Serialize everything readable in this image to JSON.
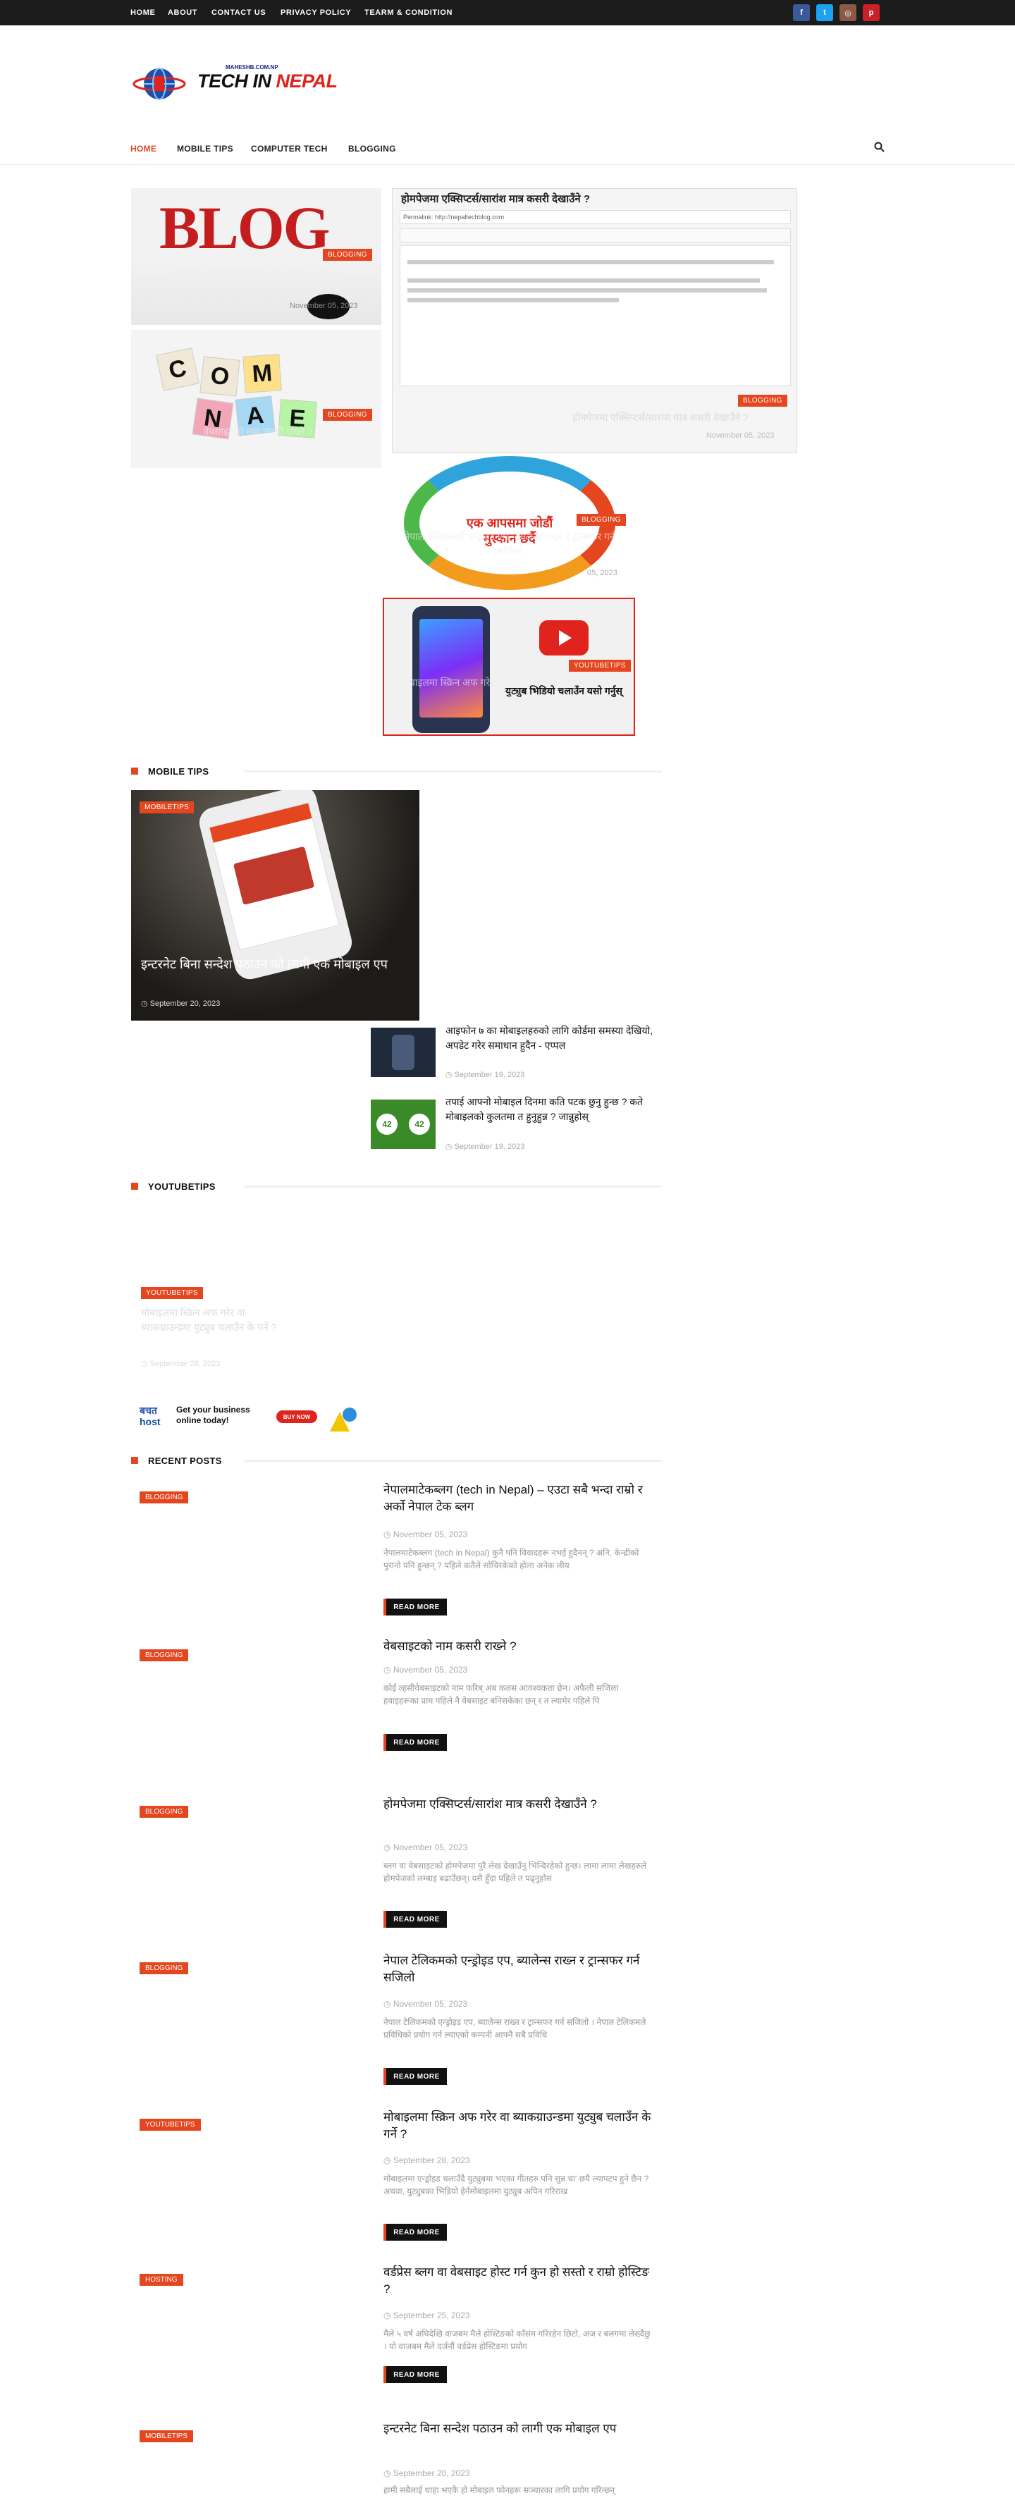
{
  "topbar": {
    "links": [
      "HOME",
      "ABOUT",
      "CONTACT US",
      "PRIVACY POLICY",
      "TEARM & CONDITION"
    ],
    "social": [
      {
        "icon": "facebook-icon",
        "glyph": "f",
        "color": "#3b5998"
      },
      {
        "icon": "twitter-icon",
        "glyph": "t",
        "color": "#1da1f2"
      },
      {
        "icon": "instagram-icon",
        "glyph": "◎",
        "color": "#8a5a44"
      },
      {
        "icon": "pinterest-icon",
        "glyph": "p",
        "color": "#cb2027"
      }
    ]
  },
  "header": {
    "logo_small": "MAHESHB.COM.NP",
    "logo_main": "TECH IN",
    "logo_accent": "NEPAL"
  },
  "nav": {
    "items": [
      "HOME",
      "MOBILE TIPS",
      "COMPUTER TECH",
      "BLOGGING"
    ],
    "search_icon": "search-icon"
  },
  "featured": [
    {
      "badge": "BLOGGING",
      "title": "होमपेजमा एक्सिप्टर्स/सारांश मात्र कसरी देखाउँने ?",
      "date": "November 05, 2023",
      "image_text": "BLOG"
    },
    {
      "badge": "BLOGGING",
      "title": "वेबसाइटको नाम कसरी राख्ने ?",
      "date": "",
      "image_text": "NAME"
    },
    {
      "badge": "BLOGGING",
      "title": "होमपेजमा एक्सिप्टर्स/सारांश मात्र कसरी देखाउँने ?",
      "date": "November 05, 2023",
      "image_text": "होमपेजमा एक्सिप्टर्स/सारांश मात्र कसरी देखाउँने ?"
    },
    {
      "badge": "BLOGGING",
      "title": "नेपाल टेलिकमको एन्ड्रोइड एप, ब्यालेन्स राख्न र ट्रान्सफर गर्न सजिलो",
      "date": "05, 2023",
      "image_text": "एक आपसमा जोडौं मुस्कान छर्दै"
    },
    {
      "badge": "YOUTUBETIPS",
      "title": "मोबाइलमा स्क्रिन अफ गरेर वा ब्याकग्राउन्डमा युट्युब चलाउँन के गर्ने ?",
      "date": "",
      "image_text": "युट्युब भिडियो चलाउँन यसो गर्नुस्"
    }
  ],
  "mobile_tips": {
    "heading": "MOBILE TIPS",
    "main": {
      "badge": "MOBILETIPS",
      "title": "इन्टरनेट बिना सन्देश पठाउन को लागी एक मोबाइल एप",
      "date": "September 20, 2023"
    },
    "list": [
      {
        "title": "आइफोन ७ का मोबाइलहरुको लागि कोर्डमा समस्या देखियो, अपडेट गरेर समाधान हुदैन - एप्पल",
        "date": "September 19, 2023"
      },
      {
        "title": "तपाई आफ्नो मोबाइल दिनमा कति पटक छुनु हुन्छ ? कते मोबाइलको कुलतमा त हुनुहुन्न ? जान्नुहोस्",
        "date": "September 19, 2023"
      }
    ]
  },
  "youtube_tips": {
    "heading": "YOUTUBETIPS",
    "badge": "YOUTUBETIPS",
    "title": "मोबाइलमा स्क्रिन अफ गरेर वा ब्याकग्राउन्डमा युट्युब चलाउँन के गर्ने ?",
    "date": "September 28, 2023"
  },
  "ad": {
    "brand": "बचत host",
    "text": "Get your business online today!",
    "button": "BUY NOW"
  },
  "recent": {
    "heading": "RECENT POSTS",
    "read_more": "READ MORE",
    "posts": [
      {
        "badge": "BLOGGING",
        "title": "नेपालमाटेकब्लग (tech in Nepal) – एउटा सबै भन्दा राम्रो र अर्को नेपाल टेक ब्लग",
        "date": "November 05, 2023",
        "excerpt": "नेपालमाटेकब्लग (tech in Nepal) कुनै पनि विवादहरू नभई हुदैनन् ? अनि, केन्द्रीको पुरानो पनि हुन्छन् ? पहिले कतैले सोचिरकेको होला अनेक लीय"
      },
      {
        "badge": "BLOGGING",
        "title": "वेबसाइटको नाम कसरी राख्ने ?",
        "date": "November 05, 2023",
        "excerpt": "कोई ल्हसीवेबसाइटको नाम फरिब् अब कलस आवश्यकता छेन। अफैली सजिला हवाइहरूका प्राय पहिले नै वेबसाइट बनिसकेका छन् र त ल्यामेर पहिले पि"
      },
      {
        "badge": "BLOGGING",
        "title": "होमपेजमा एक्सिप्टर्स/सारांश मात्र कसरी देखाउँने ?",
        "date": "November 05, 2023",
        "excerpt": "ब्लग वा वेबसाइटको होमपेजमा पुरै लेख देखाउँनु भिन्दिरहेको हुन्छ। लामा लामा लेखहरुले होमपेजको लम्बाइ बढाउँछन्। यसै हुँदा पहिले त पढ्नुहोस"
      },
      {
        "badge": "BLOGGING",
        "title": "नेपाल टेलिकमको एन्ड्रोइड एप, ब्यालेन्स राख्न र ट्रान्सफर गर्न सजिलो",
        "date": "November 05, 2023",
        "excerpt": "नेपाल टेलिकमको एन्ड्रोइड एप, ब्यालेन्स राख्न र ट्रान्सफर गर्न सजिलो । नेपाल टेलिकमले प्रविधिको प्रयोग गर्न ल्याएको कम्पनी आफ्नै सबै प्रविधि"
      },
      {
        "badge": "YOUTUBETIPS",
        "title": "मोबाइलमा स्क्रिन अफ गरेर वा ब्याकग्राउन्डमा युट्युब चलाउँन के गर्ने ?",
        "date": "September 28, 2023",
        "excerpt": "मोबाइलमा एन्ड्रोइड चलाउँदै युट्युबमा भएका गीतहरु पनि सुन्न चा' छयै ल्यापटप हुने छैन ? अथवा, युट्युबका भिडियो हेर्नमोबाइलमा युट्युब अपिन गरिराख"
      },
      {
        "badge": "HOSTING",
        "title": "वर्डप्रेस ब्लग वा वेबसाइट होस्ट गर्न कुन हो सस्तो र राम्रो होस्टिङ ?",
        "date": "September 25, 2023",
        "excerpt": "मैले ५ वर्ष अघिदेखि वाजबम मैले होस्टिङको काँसंम गरिरहेन छिटो, अज र बलगमा लेख्दैछु । यो वाजबम मैले दर्जनौं वर्डप्रेस होस्टिङमा प्रयोग"
      },
      {
        "badge": "MOBILETIPS",
        "title": "इन्टरनेट बिना सन्देश पठाउन को लागी एक मोबाइल एप",
        "date": "September 20, 2023",
        "excerpt": "हामी सबैलाई थाहा भएकै हो मोबाइल फोनहरू सञ्चारका लागि प्रयोग गरिन्छन्"
      }
    ]
  }
}
